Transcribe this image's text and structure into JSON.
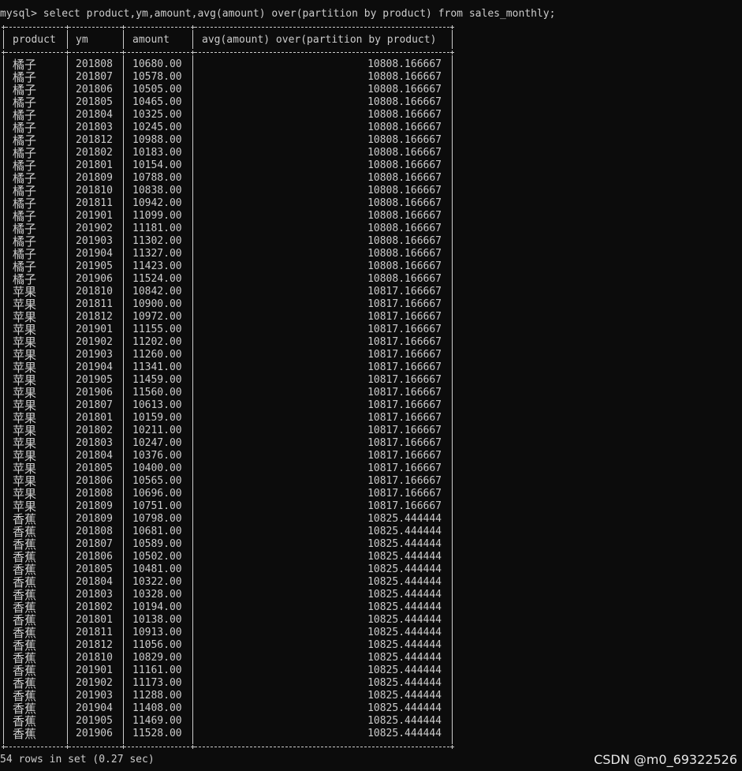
{
  "terminal": {
    "prompt": "mysql>",
    "command": "select product,ym,amount,avg(amount) over(partition by product) from sales_monthly;",
    "status": "54 rows in set (0.27 sec)",
    "watermark": "CSDN @m0_69322526"
  },
  "table": {
    "headers": [
      "product",
      "ym",
      "amount",
      "avg(amount) over(partition by product)"
    ],
    "rows": [
      [
        "橘子",
        "201808",
        "10680.00",
        "10808.166667"
      ],
      [
        "橘子",
        "201807",
        "10578.00",
        "10808.166667"
      ],
      [
        "橘子",
        "201806",
        "10505.00",
        "10808.166667"
      ],
      [
        "橘子",
        "201805",
        "10465.00",
        "10808.166667"
      ],
      [
        "橘子",
        "201804",
        "10325.00",
        "10808.166667"
      ],
      [
        "橘子",
        "201803",
        "10245.00",
        "10808.166667"
      ],
      [
        "橘子",
        "201812",
        "10988.00",
        "10808.166667"
      ],
      [
        "橘子",
        "201802",
        "10183.00",
        "10808.166667"
      ],
      [
        "橘子",
        "201801",
        "10154.00",
        "10808.166667"
      ],
      [
        "橘子",
        "201809",
        "10788.00",
        "10808.166667"
      ],
      [
        "橘子",
        "201810",
        "10838.00",
        "10808.166667"
      ],
      [
        "橘子",
        "201811",
        "10942.00",
        "10808.166667"
      ],
      [
        "橘子",
        "201901",
        "11099.00",
        "10808.166667"
      ],
      [
        "橘子",
        "201902",
        "11181.00",
        "10808.166667"
      ],
      [
        "橘子",
        "201903",
        "11302.00",
        "10808.166667"
      ],
      [
        "橘子",
        "201904",
        "11327.00",
        "10808.166667"
      ],
      [
        "橘子",
        "201905",
        "11423.00",
        "10808.166667"
      ],
      [
        "橘子",
        "201906",
        "11524.00",
        "10808.166667"
      ],
      [
        "苹果",
        "201810",
        "10842.00",
        "10817.166667"
      ],
      [
        "苹果",
        "201811",
        "10900.00",
        "10817.166667"
      ],
      [
        "苹果",
        "201812",
        "10972.00",
        "10817.166667"
      ],
      [
        "苹果",
        "201901",
        "11155.00",
        "10817.166667"
      ],
      [
        "苹果",
        "201902",
        "11202.00",
        "10817.166667"
      ],
      [
        "苹果",
        "201903",
        "11260.00",
        "10817.166667"
      ],
      [
        "苹果",
        "201904",
        "11341.00",
        "10817.166667"
      ],
      [
        "苹果",
        "201905",
        "11459.00",
        "10817.166667"
      ],
      [
        "苹果",
        "201906",
        "11560.00",
        "10817.166667"
      ],
      [
        "苹果",
        "201807",
        "10613.00",
        "10817.166667"
      ],
      [
        "苹果",
        "201801",
        "10159.00",
        "10817.166667"
      ],
      [
        "苹果",
        "201802",
        "10211.00",
        "10817.166667"
      ],
      [
        "苹果",
        "201803",
        "10247.00",
        "10817.166667"
      ],
      [
        "苹果",
        "201804",
        "10376.00",
        "10817.166667"
      ],
      [
        "苹果",
        "201805",
        "10400.00",
        "10817.166667"
      ],
      [
        "苹果",
        "201806",
        "10565.00",
        "10817.166667"
      ],
      [
        "苹果",
        "201808",
        "10696.00",
        "10817.166667"
      ],
      [
        "苹果",
        "201809",
        "10751.00",
        "10817.166667"
      ],
      [
        "香蕉",
        "201809",
        "10798.00",
        "10825.444444"
      ],
      [
        "香蕉",
        "201808",
        "10681.00",
        "10825.444444"
      ],
      [
        "香蕉",
        "201807",
        "10589.00",
        "10825.444444"
      ],
      [
        "香蕉",
        "201806",
        "10502.00",
        "10825.444444"
      ],
      [
        "香蕉",
        "201805",
        "10481.00",
        "10825.444444"
      ],
      [
        "香蕉",
        "201804",
        "10322.00",
        "10825.444444"
      ],
      [
        "香蕉",
        "201803",
        "10328.00",
        "10825.444444"
      ],
      [
        "香蕉",
        "201802",
        "10194.00",
        "10825.444444"
      ],
      [
        "香蕉",
        "201801",
        "10138.00",
        "10825.444444"
      ],
      [
        "香蕉",
        "201811",
        "10913.00",
        "10825.444444"
      ],
      [
        "香蕉",
        "201812",
        "11056.00",
        "10825.444444"
      ],
      [
        "香蕉",
        "201810",
        "10829.00",
        "10825.444444"
      ],
      [
        "香蕉",
        "201901",
        "11161.00",
        "10825.444444"
      ],
      [
        "香蕉",
        "201902",
        "11173.00",
        "10825.444444"
      ],
      [
        "香蕉",
        "201903",
        "11288.00",
        "10825.444444"
      ],
      [
        "香蕉",
        "201904",
        "11408.00",
        "10825.444444"
      ],
      [
        "香蕉",
        "201905",
        "11469.00",
        "10825.444444"
      ],
      [
        "香蕉",
        "201906",
        "11528.00",
        "10825.444444"
      ]
    ]
  },
  "colors": {
    "background": "#0c0c0c",
    "text": "#cccccc"
  }
}
